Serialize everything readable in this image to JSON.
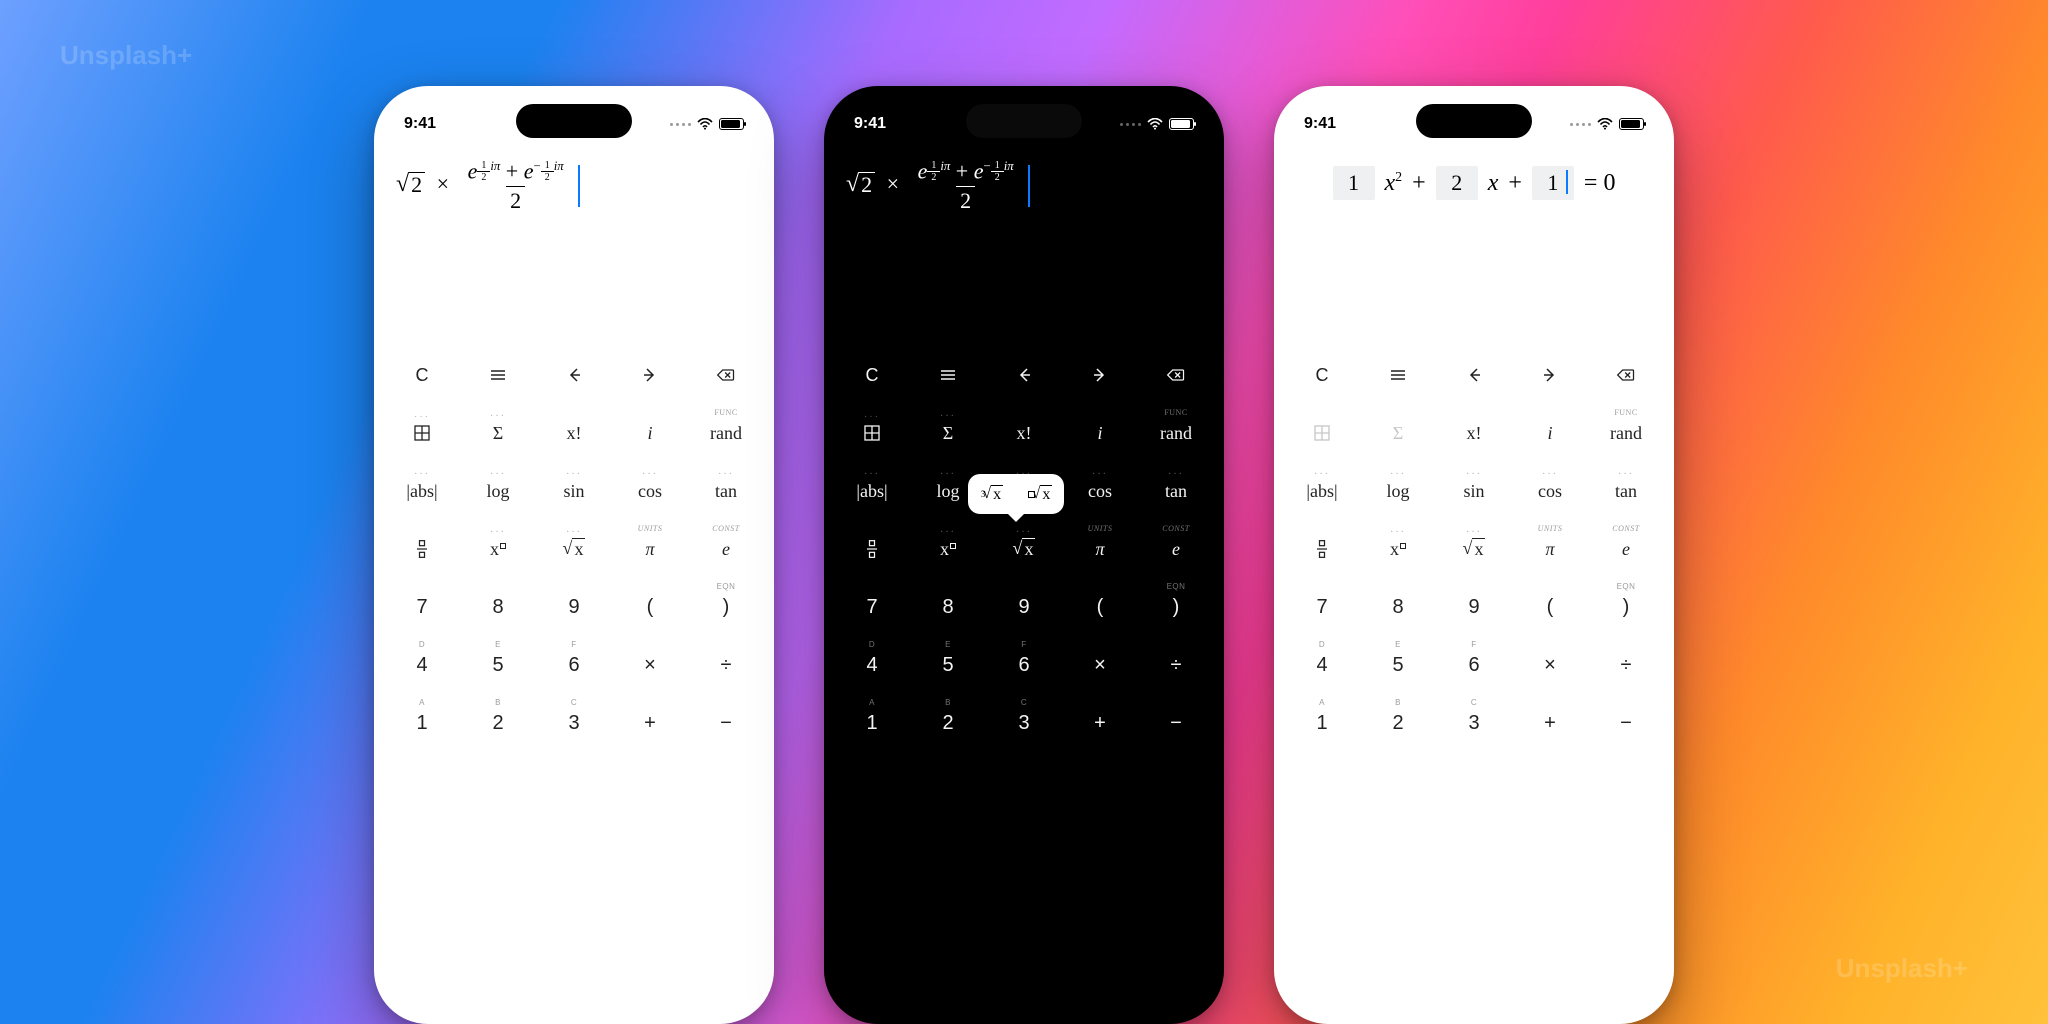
{
  "watermarks": [
    "Unsplash+",
    "Unsplash+"
  ],
  "statusbar": {
    "time": "9:41"
  },
  "expression": {
    "sqrt_radicand": "2",
    "mult": "×",
    "e": "e",
    "half_num": "1",
    "half_den": "2",
    "ipi": "iπ",
    "plus": "+",
    "minus": "−",
    "denom": "2"
  },
  "quadratic": {
    "a": "1",
    "b": "2",
    "c": "1",
    "x2": "x",
    "sq": "2",
    "x": "x",
    "plus": "+",
    "eq": "= 0"
  },
  "popup": {
    "cbrt_pre": "3",
    "cbrt_body": "x",
    "nthroot_body": "x"
  },
  "keys": {
    "row0": [
      "C",
      "≡",
      "←",
      "→",
      "⌫"
    ],
    "row1": {
      "matrix": "",
      "sigma": "Σ",
      "fact": "x!",
      "i": "i",
      "rand": "rand",
      "rand_alt": "FUNC"
    },
    "row2": {
      "abs": "|abs|",
      "log": "log",
      "sin": "sin",
      "cos": "cos",
      "tan": "tan"
    },
    "row3": {
      "frac": "",
      "xpow": "x",
      "xpow_box": "▫",
      "sqrtx": "x",
      "pi": "π",
      "e": "e",
      "pi_alt": "UNITS",
      "e_alt": "CONST"
    },
    "row4": {
      "k7": "7",
      "k8": "8",
      "k9": "9",
      "lp": "(",
      "rp": ")",
      "rp_alt": "EQN"
    },
    "row5": {
      "k4": "4",
      "k5": "5",
      "k6": "6",
      "times": "×",
      "div": "÷",
      "d": "D",
      "e": "E",
      "f": "F"
    },
    "row6": {
      "k1": "1",
      "k2": "2",
      "k3": "3",
      "plus": "+",
      "minus": "−",
      "a": "A",
      "b": "B",
      "c": "C"
    }
  }
}
